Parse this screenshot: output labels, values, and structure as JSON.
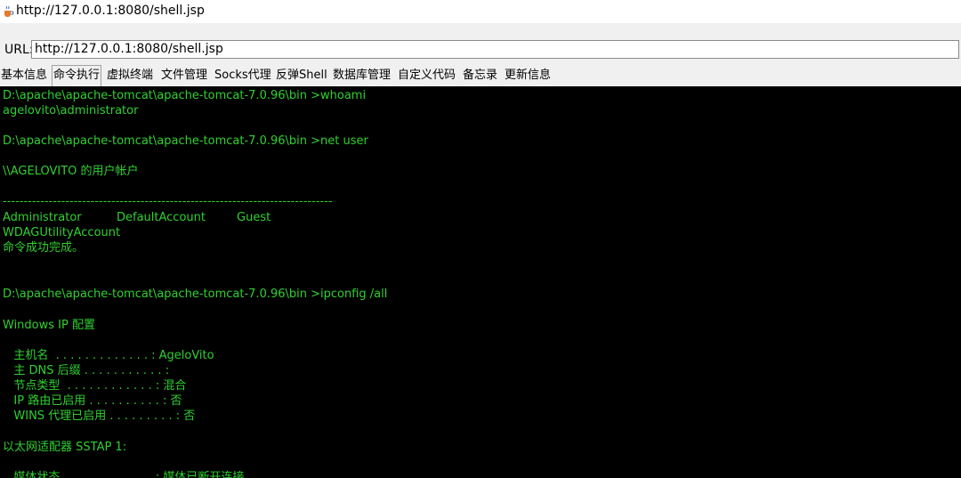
{
  "window": {
    "title": "http://127.0.0.1:8080/shell.jsp",
    "icon": "java-cup-icon"
  },
  "urlbar": {
    "label": "URL:",
    "value": "http://127.0.0.1:8080/shell.jsp"
  },
  "tabs": [
    {
      "label": "基本信息",
      "active": false
    },
    {
      "label": "命令执行",
      "active": true
    },
    {
      "label": "虚拟终端",
      "active": false
    },
    {
      "label": "文件管理",
      "active": false
    },
    {
      "label": "Socks代理",
      "active": false
    },
    {
      "label": "反弹Shell",
      "active": false
    },
    {
      "label": "数据库管理",
      "active": false
    },
    {
      "label": "自定义代码",
      "active": false
    },
    {
      "label": "备忘录",
      "active": false
    },
    {
      "label": "更新信息",
      "active": false
    }
  ],
  "terminal": {
    "text_color": "#2fd12f",
    "background": "#000000",
    "cmd1": "D:\\apache\\apache-tomcat\\apache-tomcat-7.0.96\\bin >whoami",
    "out1": "agelovito\\administrator",
    "cmd2": "D:\\apache\\apache-tomcat\\apache-tomcat-7.0.96\\bin >net user",
    "net_header": "\\\\AGELOVITO 的用户帐户",
    "separator": "-------------------------------------------------------------------------------",
    "user1": "Administrator",
    "user2": "DefaultAccount",
    "user3": "Guest",
    "user4": "WDAGUtilityAccount",
    "net_done": "命令成功完成。",
    "cmd3": "D:\\apache\\apache-tomcat\\apache-tomcat-7.0.96\\bin >ipconfig /all",
    "ipconfig_header": "Windows IP 配置",
    "host_name": "   主机名  . . . . . . . . . . . . . : AgeloVito",
    "dns_suffix": "   主 DNS 后缀 . . . . . . . . . . . :",
    "node_type": "   节点类型  . . . . . . . . . . . . : 混合",
    "ip_routing": "   IP 路由已启用 . . . . . . . . . . : 否",
    "wins_proxy": "   WINS 代理已启用 . . . . . . . . . : 否",
    "adapter": "以太网适配器 SSTAP 1:",
    "media_state": "   媒体状态  . . . . . . . . . . . . : 媒体已断开连接"
  }
}
